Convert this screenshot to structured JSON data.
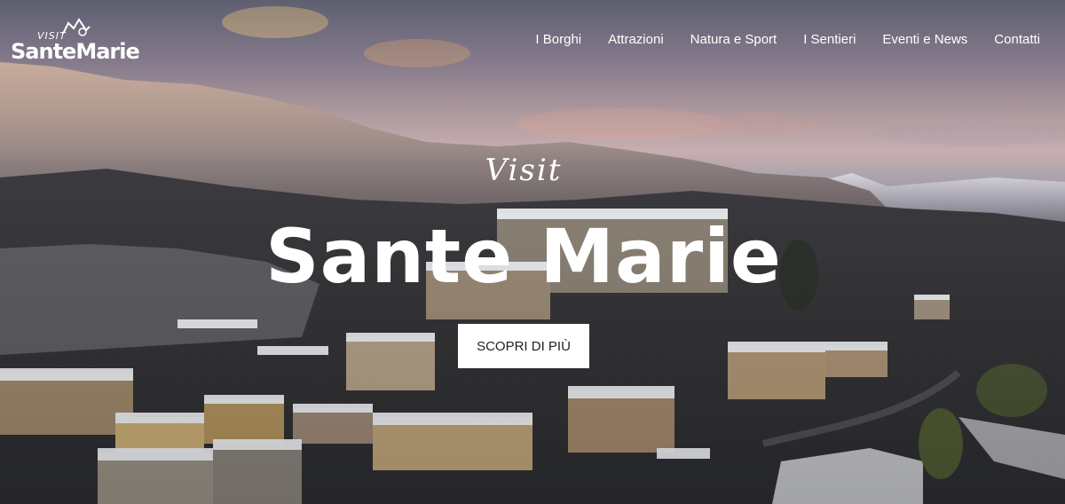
{
  "brand": {
    "visit": "VISIT",
    "name": "SanteMarie"
  },
  "nav": {
    "items": [
      {
        "label": "I Borghi"
      },
      {
        "label": "Attrazioni"
      },
      {
        "label": "Natura e Sport"
      },
      {
        "label": "I Sentieri"
      },
      {
        "label": "Eventi e News"
      },
      {
        "label": "Contatti"
      }
    ]
  },
  "hero": {
    "kicker": "Visit",
    "title": "Sante Marie",
    "cta_label": "SCOPRI DI PIÙ"
  },
  "colors": {
    "text": "#ffffff",
    "button_bg": "#ffffff",
    "button_text": "#222222"
  }
}
